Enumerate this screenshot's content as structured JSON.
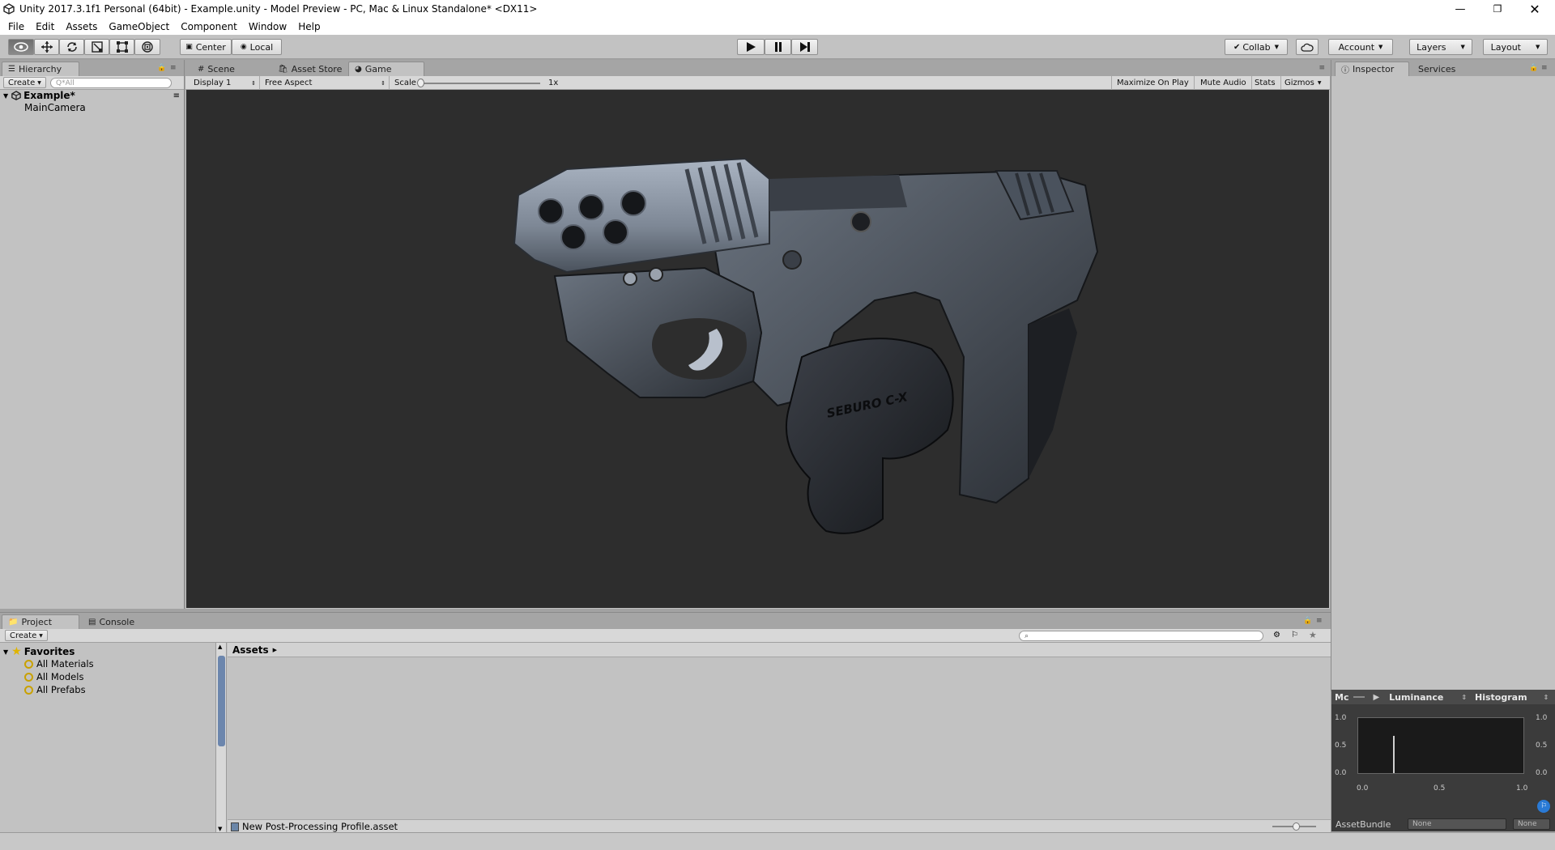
{
  "window": {
    "title": "Unity 2017.3.1f1 Personal (64bit) - Example.unity - Model Preview - PC, Mac & Linux Standalone* <DX11>"
  },
  "menu": [
    "File",
    "Edit",
    "Assets",
    "GameObject",
    "Component",
    "Window",
    "Help"
  ],
  "toolbar": {
    "pivot_label": "Center",
    "space_label": "Local",
    "collab_label": "Collab",
    "account_label": "Account",
    "layers_label": "Layers",
    "layout_label": "Layout"
  },
  "hierarchy": {
    "tab_label": "Hierarchy",
    "create_label": "Create",
    "search_placeholder": "Q*All",
    "scene_name": "Example*",
    "objects": [
      "MainCamera"
    ]
  },
  "center_tabs": [
    "Scene",
    "Asset Store",
    "Game"
  ],
  "game_view": {
    "display": "Display 1",
    "aspect": "Free Aspect",
    "scale_label": "Scale",
    "scale_value": "1x",
    "maximize_label": "Maximize On Play",
    "mute_label": "Mute Audio",
    "stats_label": "Stats",
    "gizmos_label": "Gizmos",
    "model_text_grip": "SEBURO C-X",
    "colors": {
      "viewport_bg": "#2d2d2d",
      "gun_metal": "#7d8795",
      "gun_dark": "#1d1f23"
    }
  },
  "inspector": {
    "tabs": [
      "Inspector",
      "Services"
    ]
  },
  "histogram": {
    "mode_label": "Mc",
    "channel_label": "Luminance",
    "type_label": "Histogram",
    "y_ticks": [
      "1.0",
      "0.5",
      "0.0"
    ],
    "x_ticks": [
      "0.0",
      "0.5",
      "1.0"
    ],
    "assetbundle_label": "AssetBundle",
    "assetbundle_value": "None",
    "variant_value": "None"
  },
  "project": {
    "tabs": [
      "Project",
      "Console"
    ],
    "create_label": "Create",
    "favorites_label": "Favorites",
    "favorites": [
      "All Materials",
      "All Models",
      "All Prefabs"
    ],
    "breadcrumb": "Assets",
    "selected_asset": "New Post-Processing Profile.asset"
  }
}
